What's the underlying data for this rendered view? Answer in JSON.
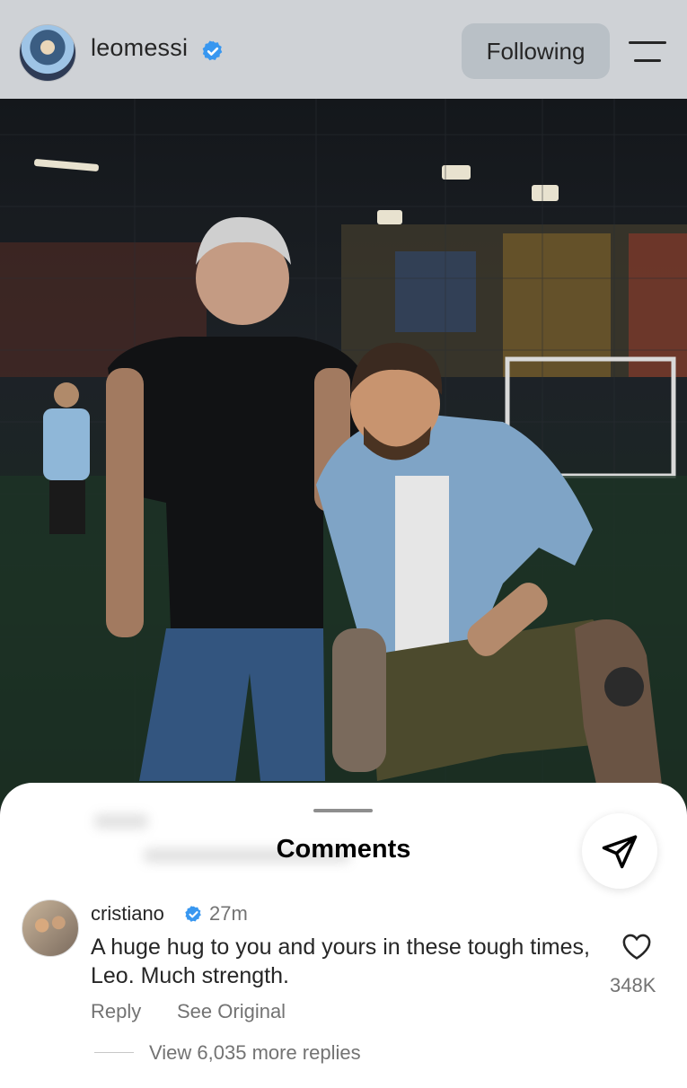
{
  "header": {
    "username": "leomessi",
    "follow_label": "Following"
  },
  "comments_sheet": {
    "title": "Comments",
    "comment": {
      "username": "cristiano",
      "time": "27m",
      "text": "A huge hug to you and yours in these tough times, Leo. Much strength.",
      "like_count": "348K",
      "reply_label": "Reply",
      "see_original_label": "See Original",
      "view_replies_label": "View 6,035 more replies"
    }
  },
  "colors": {
    "verified": "#3897f0",
    "header_bg": "#cfd2d6",
    "follow_bg": "#b9c0c6"
  },
  "icons": [
    "verified-badge-icon",
    "menu-icon",
    "share-icon",
    "heart-icon"
  ]
}
